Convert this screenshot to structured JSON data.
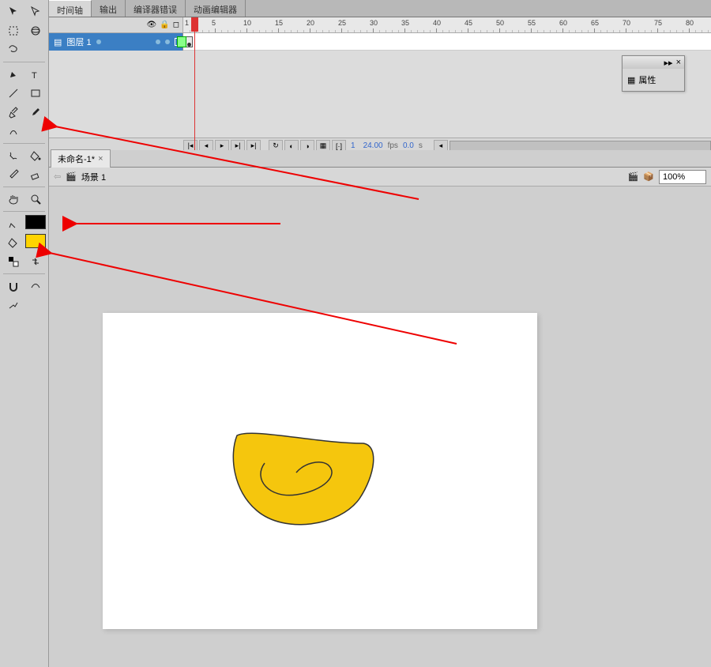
{
  "tabs": {
    "timeline": "时间轴",
    "output": "输出",
    "compiler_errors": "编译器错误",
    "anim_editor": "动画编辑器"
  },
  "layer": {
    "name": "图层 1"
  },
  "ruler": {
    "start": 1,
    "step": 5,
    "count": 16
  },
  "timeline_footer": {
    "frame": "1",
    "fps": "24.00",
    "fps_unit": "fps",
    "time": "0.0",
    "time_unit": "s"
  },
  "properties": {
    "title": "属性"
  },
  "document": {
    "name": "未命名-1*"
  },
  "scene": {
    "name": "场景 1",
    "zoom": "100%"
  },
  "colors": {
    "stroke": "#000000",
    "fill": "#ffd400"
  }
}
